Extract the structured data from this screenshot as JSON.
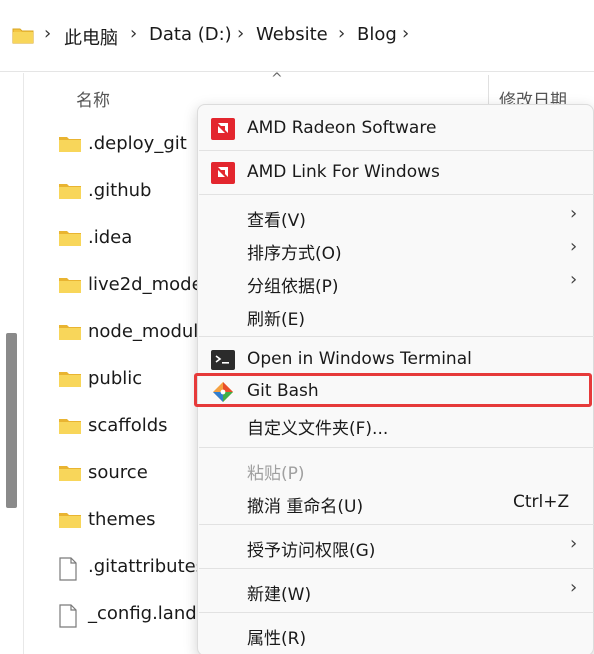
{
  "breadcrumb": {
    "icon": "folder-icon",
    "items": [
      "此电脑",
      "Data (D:)",
      "Website",
      "Blog"
    ],
    "separator": ">"
  },
  "columns": {
    "name": "名称",
    "date": "修改日期"
  },
  "files": [
    {
      "name": ".deploy_git",
      "icon": "folder-icon"
    },
    {
      "name": ".github",
      "icon": "folder-icon"
    },
    {
      "name": ".idea",
      "icon": "folder-icon"
    },
    {
      "name": "live2d_mode",
      "icon": "folder-icon"
    },
    {
      "name": "node_modul",
      "icon": "folder-icon"
    },
    {
      "name": "public",
      "icon": "folder-icon"
    },
    {
      "name": "scaffolds",
      "icon": "folder-icon"
    },
    {
      "name": "source",
      "icon": "folder-icon"
    },
    {
      "name": "themes",
      "icon": "folder-icon"
    },
    {
      "name": ".gitattributes",
      "icon": "file-icon"
    },
    {
      "name": "_config.lands",
      "icon": "file-icon"
    }
  ],
  "menu": {
    "amd_radeon": "AMD Radeon Software",
    "amd_link": "AMD Link For Windows",
    "view": "查看(V)",
    "sort": "排序方式(O)",
    "group": "分组依据(P)",
    "refresh": "刷新(E)",
    "terminal": "Open in Windows Terminal",
    "git_bash": "Git Bash",
    "customize": "自定义文件夹(F)...",
    "paste": "粘贴(P)",
    "undo": "撤消 重命名(U)",
    "undo_shortcut": "Ctrl+Z",
    "access": "授予访问权限(G)",
    "new": "新建(W)",
    "properties": "属性(R)"
  },
  "colors": {
    "amd_red": "#e3262e",
    "highlight_border": "#e63a3a",
    "folder_yellow": "#f4c542"
  }
}
